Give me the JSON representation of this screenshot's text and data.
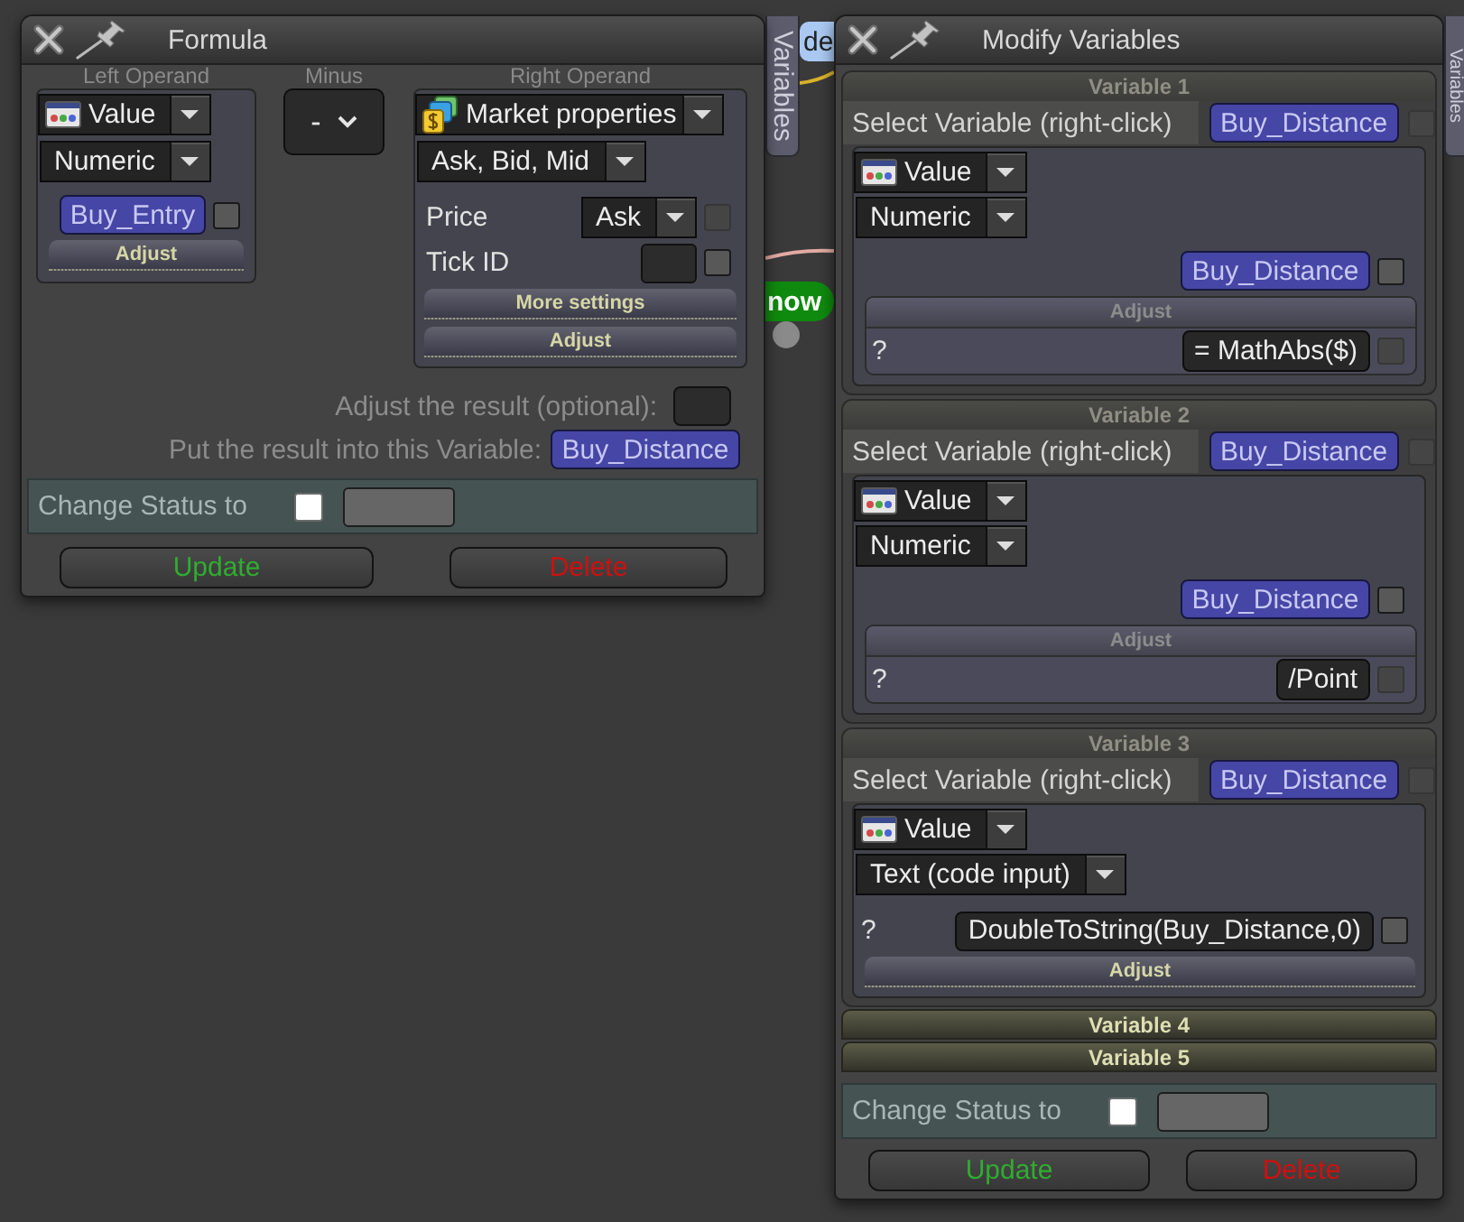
{
  "formula": {
    "title": "Formula",
    "side_tab": "Variables",
    "left_operand": {
      "label": "Left Operand",
      "source": "Value",
      "type": "Numeric",
      "variable": "Buy_Entry",
      "variable_check": {
        "checked": false,
        "disabled": false
      },
      "adjust": "Adjust"
    },
    "operator": {
      "label": "Minus",
      "value": "-"
    },
    "right_operand": {
      "label": "Right Operand",
      "source": "Market properties",
      "category": "Ask, Bid, Mid",
      "fields": [
        {
          "kind": "dropdown",
          "label": "Price",
          "value": "Ask",
          "checked": false,
          "disabled": true
        },
        {
          "kind": "input",
          "label": "Tick ID",
          "checked": false,
          "disabled": false
        }
      ],
      "buttons": [
        "More settings",
        "Adjust"
      ]
    },
    "adjust_result": {
      "label": "Adjust the result (optional):"
    },
    "result_variable": {
      "label": "Put the result into this Variable:",
      "value": "Buy_Distance"
    },
    "change_status": {
      "label": "Change Status to",
      "checked": false
    },
    "buttons": [
      {
        "kind": "update",
        "label": "Update"
      },
      {
        "kind": "delete",
        "label": "Delete"
      }
    ]
  },
  "canvas": {
    "node_label": "de",
    "badge": "now"
  },
  "modify": {
    "title": "Modify Variables",
    "side_tab": "Variables",
    "variables": [
      {
        "title": "Variable 1",
        "expanded": true,
        "kind": "numeric",
        "select_label": "Select Variable (right-click)",
        "variable": "Buy_Distance",
        "select_check": {
          "checked": false,
          "disabled": true
        },
        "source": "Value",
        "type": "Numeric",
        "value": "Buy_Distance",
        "value_check": {
          "checked": false,
          "disabled": false
        },
        "adjust": {
          "label": "Adjust",
          "expanded": true,
          "hint": "?",
          "value": "= MathAbs($)",
          "checked": false,
          "disabled": true
        }
      },
      {
        "title": "Variable 2",
        "expanded": true,
        "kind": "numeric",
        "select_label": "Select Variable (right-click)",
        "variable": "Buy_Distance",
        "select_check": {
          "checked": false,
          "disabled": true
        },
        "source": "Value",
        "type": "Numeric",
        "value": "Buy_Distance",
        "value_check": {
          "checked": false,
          "disabled": false
        },
        "adjust": {
          "label": "Adjust",
          "expanded": true,
          "hint": "?",
          "value": "/Point",
          "checked": false,
          "disabled": true
        }
      },
      {
        "title": "Variable 3",
        "expanded": true,
        "kind": "code",
        "select_label": "Select Variable (right-click)",
        "variable": "Buy_Distance",
        "select_check": {
          "checked": false,
          "disabled": true
        },
        "source": "Value",
        "type": "Text (code input)",
        "hint": "?",
        "value": "DoubleToString(Buy_Distance,0)",
        "value_check": {
          "checked": false,
          "disabled": false
        },
        "adjust": {
          "label": "Adjust",
          "expanded": false
        }
      },
      {
        "title": "Variable 4",
        "expanded": false
      },
      {
        "title": "Variable 5",
        "expanded": false
      }
    ],
    "change_status": {
      "label": "Change Status to",
      "checked": false
    },
    "buttons": [
      {
        "kind": "update",
        "label": "Update"
      },
      {
        "kind": "delete",
        "label": "Delete"
      }
    ]
  }
}
